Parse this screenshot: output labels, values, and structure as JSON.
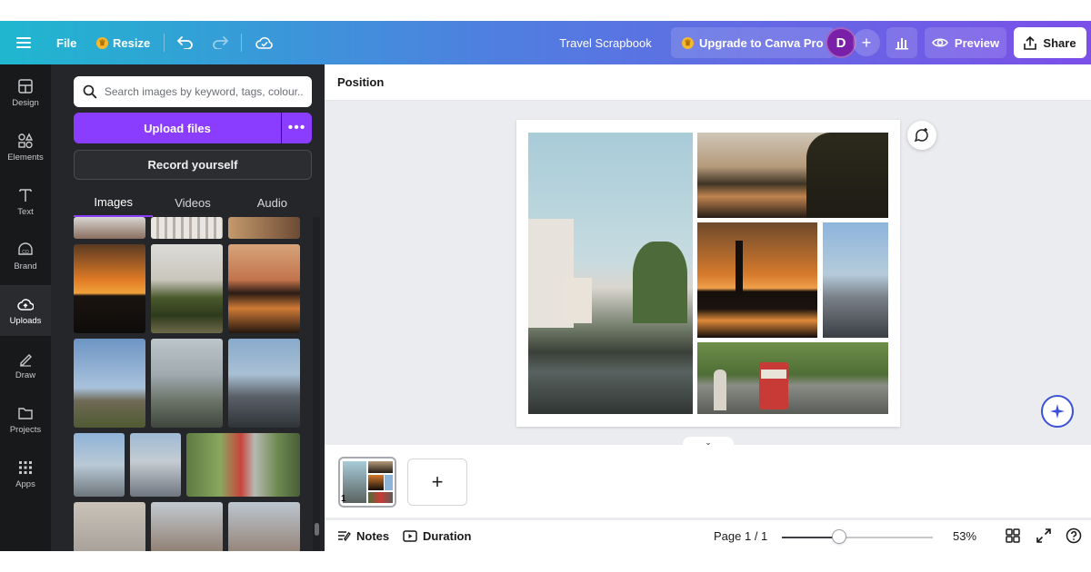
{
  "topbar": {
    "file_label": "File",
    "resize_label": "Resize",
    "doc_title": "Travel Scrapbook",
    "upgrade_label": "Upgrade to Canva Pro",
    "avatar_initial": "D",
    "preview_label": "Preview",
    "share_label": "Share",
    "accent": "#8b3dff"
  },
  "rail": {
    "items": [
      {
        "label": "Design",
        "icon": "layout-icon"
      },
      {
        "label": "Elements",
        "icon": "shapes-icon"
      },
      {
        "label": "Text",
        "icon": "text-icon"
      },
      {
        "label": "Brand",
        "icon": "brand-icon"
      },
      {
        "label": "Uploads",
        "icon": "cloud-upload-icon"
      },
      {
        "label": "Draw",
        "icon": "pen-icon"
      },
      {
        "label": "Projects",
        "icon": "folder-icon"
      },
      {
        "label": "Apps",
        "icon": "apps-grid-icon"
      }
    ],
    "active": "Uploads"
  },
  "panel": {
    "search_placeholder": "Search images by keyword, tags, colour...",
    "upload_label": "Upload files",
    "record_label": "Record yourself",
    "tabs": [
      "Images",
      "Videos",
      "Audio"
    ],
    "active_tab": "Images"
  },
  "toolbar": {
    "position_label": "Position"
  },
  "pages": {
    "current_page_badge": "1"
  },
  "footer": {
    "notes_label": "Notes",
    "duration_label": "Duration",
    "page_count": "Page 1 / 1",
    "zoom": "53%",
    "zoom_fraction": 0.53
  }
}
